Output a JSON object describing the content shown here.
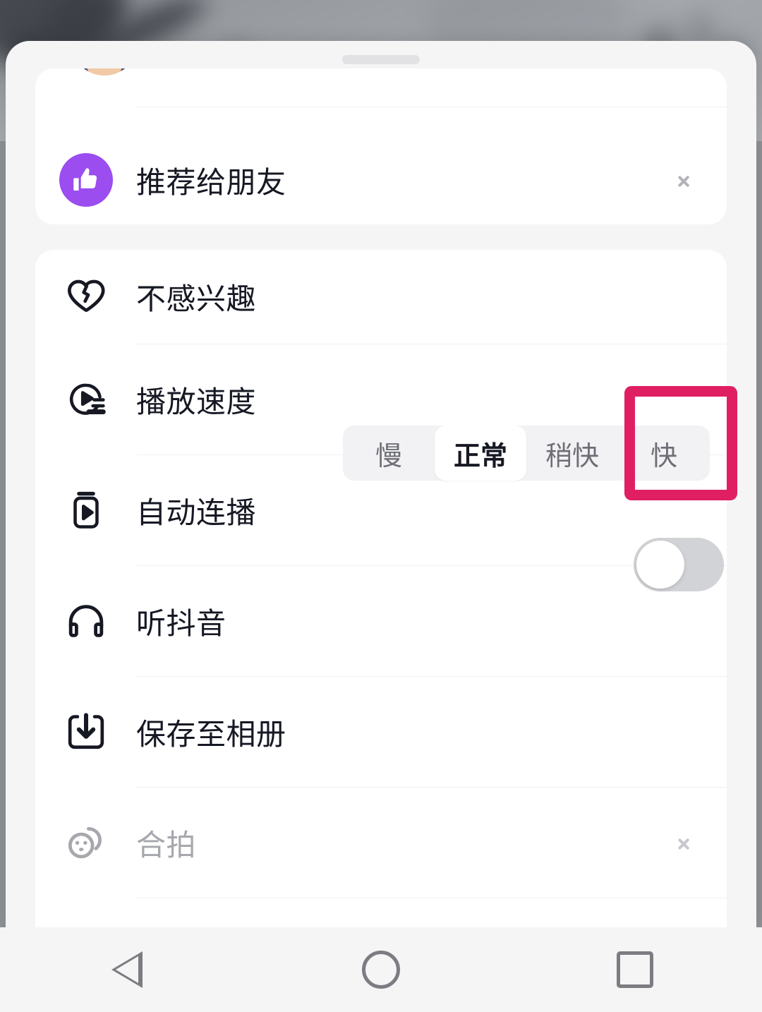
{
  "app": {
    "sheet_title": "",
    "handle": "drag-handle"
  },
  "background": {
    "type": "blurred-video-frame",
    "description": "blurred grayscale outdoor video frame"
  },
  "share_card": {
    "avatar": "partially-scrolled-avatar",
    "recommend": {
      "label": "推荐给朋友",
      "icon": "thumbs-up-icon",
      "icon_color": "#9b4df0",
      "chevron": "chevron-right-icon"
    }
  },
  "actions_card": {
    "not_interested": {
      "label": "不感兴趣",
      "icon": "broken-heart-icon"
    },
    "play_speed": {
      "label": "播放速度",
      "icon": "play-speed-icon",
      "options": [
        "慢",
        "正常",
        "稍快",
        "快"
      ],
      "selected": "正常",
      "highlighted": "快"
    },
    "autoplay": {
      "label": "自动连播",
      "icon": "autoplay-icon",
      "toggle_state": "off"
    },
    "listen": {
      "label": "听抖音",
      "icon": "headphones-icon"
    },
    "save": {
      "label": "保存至相册",
      "icon": "download-icon"
    },
    "duet": {
      "label": "合拍",
      "icon": "duet-faces-icon",
      "disabled": true,
      "chevron": "chevron-right-icon"
    }
  },
  "annotation": {
    "target": "快",
    "color": "#e01f63",
    "shape": "rectangle-outline"
  },
  "navbar": {
    "back": "back-triangle-icon",
    "home": "home-circle-icon",
    "recents": "recents-square-icon"
  }
}
